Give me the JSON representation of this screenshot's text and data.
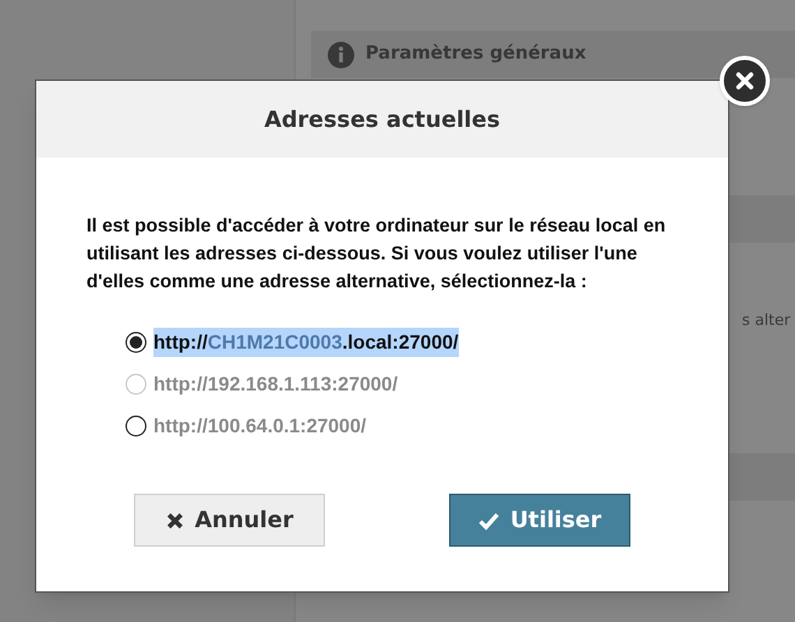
{
  "background": {
    "section_title": "Paramètres généraux",
    "fragment": "s alter"
  },
  "dialog": {
    "title": "Adresses actuelles",
    "message": "Il est possible d'accéder à votre ordinateur sur le réseau local en utilisant les adresses ci-dessous. Si vous voulez utiliser l'une d'elles comme une adresse alternative, sélectionnez-la :",
    "options": [
      {
        "selected": true,
        "disabled": false,
        "highlighted": true,
        "segments": [
          {
            "text": "http://",
            "faint": false
          },
          {
            "text": "CH1M21C0003",
            "faint": true
          },
          {
            "text": ".local:27000/",
            "faint": false
          }
        ]
      },
      {
        "selected": false,
        "disabled": true,
        "highlighted": false,
        "segments": [
          {
            "text": "http://192.168.1.113:27000/",
            "faint": true
          }
        ]
      },
      {
        "selected": false,
        "disabled": false,
        "highlighted": false,
        "segments": [
          {
            "text": "http://100.64.0.1:27000/",
            "faint": true
          }
        ]
      }
    ],
    "buttons": [
      {
        "kind": "cancel",
        "label": "Annuler"
      },
      {
        "kind": "confirm",
        "label": "Utiliser"
      }
    ]
  }
}
